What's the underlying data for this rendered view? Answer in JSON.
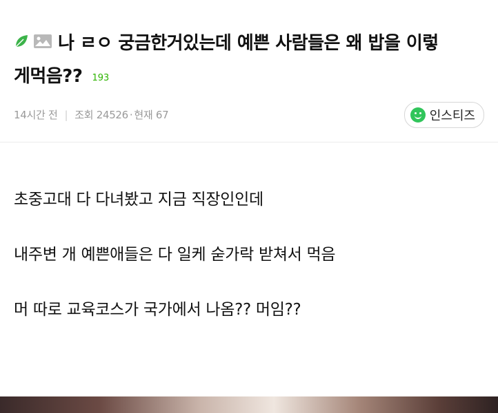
{
  "post": {
    "title_line1": "나 ㄹㅇ 궁금한거있는데 예쁜 사람들은 왜 밥을 이렇",
    "title_line2": "게먹음??",
    "comment_count": "193",
    "time": "14시간 전",
    "views_label": "조회 24526",
    "current_label": "현재 67",
    "board": "인스티즈"
  },
  "body": {
    "lines": [
      "초중고대 다 다녀봤고 지금 직장인인데",
      "내주변 개 예쁜애들은 다 일케 숟가락 받쳐서 먹음",
      "머 따로 교육코스가 국가에서 나옴?? 머임??"
    ]
  },
  "colors": {
    "accent_green": "#2db400",
    "badge_green": "#31c55b",
    "meta_gray": "#9a9a9a"
  },
  "icons": [
    "leaf-icon",
    "image-icon",
    "smile-icon"
  ]
}
